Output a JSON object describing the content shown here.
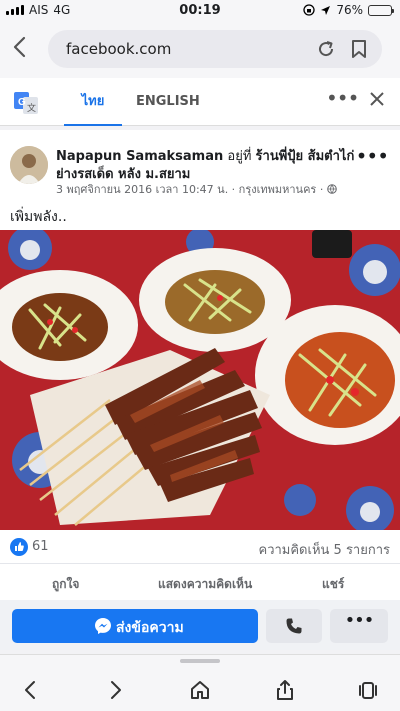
{
  "status": {
    "carrier": "AIS",
    "network": "4G",
    "time": "00:19",
    "battery": "76%",
    "battery_level": 0.76,
    "battery_color": "#f3c316"
  },
  "browser": {
    "url": "facebook.com",
    "icons": [
      "back-chevron-icon",
      "reload-icon",
      "bookmark-icon"
    ]
  },
  "translate": {
    "tab_thai": "ไทย",
    "tab_english": "ENGLISH",
    "accent": "#1a73e8"
  },
  "post": {
    "author": "Napapun Samaksaman",
    "at_text": " อยู่ที่ ",
    "place": "ร้านพี่ปุ้ย ส้มตำไก่ย่างรสเด็ด หลัง ม.สยาม",
    "meta": "3 พฤศจิกายน 2016 เวลา 10:47 น. · กรุงเทพมหานคร · ",
    "text": "เพิ่มพลัง..",
    "likes": "61",
    "comments": "ความคิดเห็น 5 รายการ",
    "actions": {
      "like": "ถูกใจ",
      "comment": "แสดงความคิดเห็น",
      "share": "แชร์"
    },
    "message_button": "ส่งข้อความ",
    "brand_color": "#1877f2"
  }
}
